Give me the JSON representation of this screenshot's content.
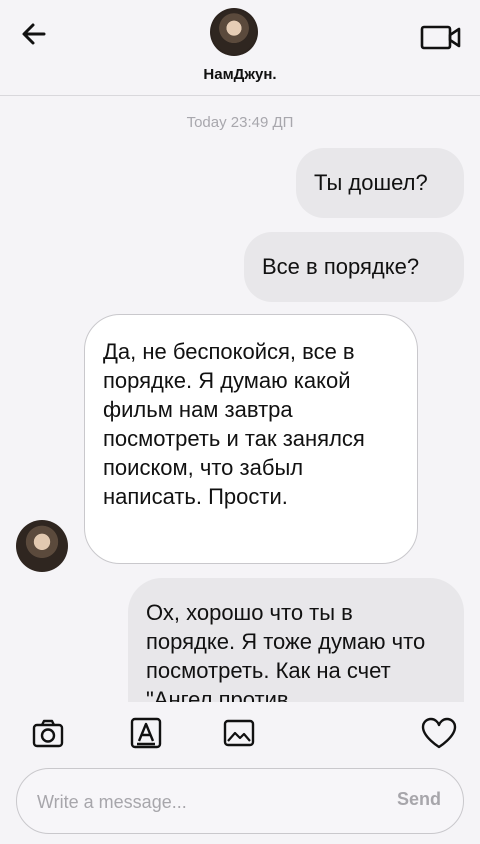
{
  "header": {
    "contact_name": "НамДжун.",
    "back_icon": "arrow-left-icon",
    "video_icon": "video-camera-icon"
  },
  "chat": {
    "timestamp": "Today 23:49 ДП",
    "messages": [
      {
        "direction": "out",
        "text": "Ты дошел?"
      },
      {
        "direction": "out",
        "text": "Все в порядке?"
      },
      {
        "direction": "in",
        "text": "Да, не беспокойся, все в порядке. Я думаю какой фильм нам завтра посмотреть и так занялся поиском, что забыл написать. Прости."
      },
      {
        "direction": "out",
        "text": "Ох, хорошо что ты в порядке. Я тоже думаю что посмотреть. Как на счет \"Ангел против"
      }
    ]
  },
  "toolbar": {
    "icons": [
      "camera-icon",
      "text-style-icon",
      "image-icon",
      "heart-icon"
    ]
  },
  "composer": {
    "placeholder": "Write a message...",
    "value": "",
    "send_label": "Send"
  },
  "colors": {
    "background": "#f5f4f7",
    "outgoing_bubble": "#e8e7ea",
    "incoming_bubble": "#ffffff",
    "muted_text": "#a7a6ab",
    "caret": "#e0306a"
  }
}
